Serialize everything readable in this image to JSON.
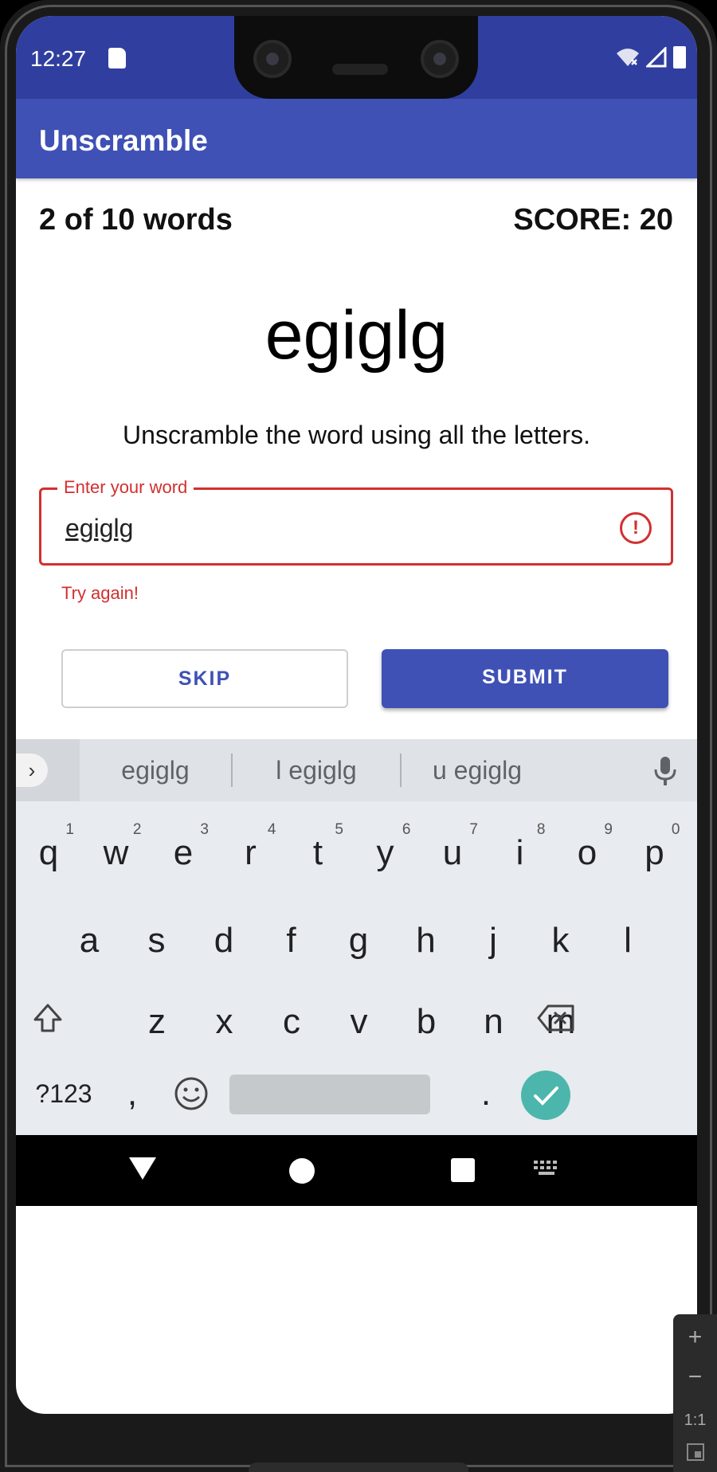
{
  "status_bar": {
    "time": "12:27"
  },
  "app_bar": {
    "title": "Unscramble"
  },
  "game": {
    "word_count": "2 of 10 words",
    "score": "SCORE: 20",
    "scrambled_word": "egiglg",
    "instructions": "Unscramble the word using all the letters."
  },
  "input": {
    "label": "Enter your word",
    "value": "egiglg",
    "error_text": "Try again!"
  },
  "buttons": {
    "skip": "SKIP",
    "submit": "SUBMIT"
  },
  "keyboard": {
    "suggestions": [
      "egiglg",
      "l egiglg",
      "u egiglg"
    ],
    "row1": [
      "q",
      "w",
      "e",
      "r",
      "t",
      "y",
      "u",
      "i",
      "o",
      "p"
    ],
    "row1_hints": [
      "1",
      "2",
      "3",
      "4",
      "5",
      "6",
      "7",
      "8",
      "9",
      "0"
    ],
    "row2": [
      "a",
      "s",
      "d",
      "f",
      "g",
      "h",
      "j",
      "k",
      "l"
    ],
    "row3": [
      "z",
      "x",
      "c",
      "v",
      "b",
      "n",
      "m"
    ],
    "symbols_label": "?123",
    "comma": ",",
    "period": "."
  },
  "emulator": {
    "plus": "+",
    "minus": "−",
    "one_to_one": "1:1"
  },
  "colors": {
    "primary": "#3f51b5",
    "primary_dark": "#303f9f",
    "error": "#d32f2f",
    "enter_key": "#4db6ac"
  }
}
